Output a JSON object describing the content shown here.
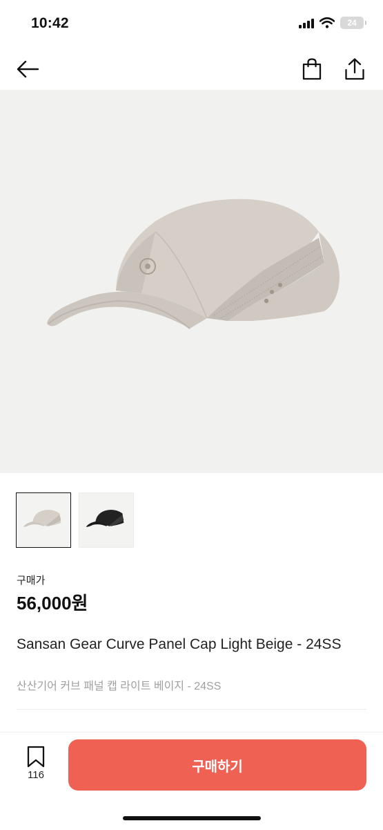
{
  "status_bar": {
    "time": "10:42",
    "battery_level": "24"
  },
  "nav": {
    "back_icon": "arrow-left-icon",
    "bag_icon": "shopping-bag-icon",
    "share_icon": "share-icon"
  },
  "product": {
    "price_label": "구매가",
    "price": "56,000원",
    "title_en": "Sansan Gear Curve Panel Cap Light Beige - 24SS",
    "title_ko": "산산기어 커브 패널 캡 라이트 베이지 - 24SS",
    "thumbnails": [
      {
        "color": "light beige",
        "selected": true
      },
      {
        "color": "black",
        "selected": false
      }
    ]
  },
  "bottom_bar": {
    "wishlist_count": "116",
    "buy_label": "구매하기"
  },
  "colors": {
    "accent": "#ef6253",
    "hero_bg": "#f1f1f0",
    "cap_beige": "#d3cdc6",
    "cap_black": "#1b1b1b"
  }
}
